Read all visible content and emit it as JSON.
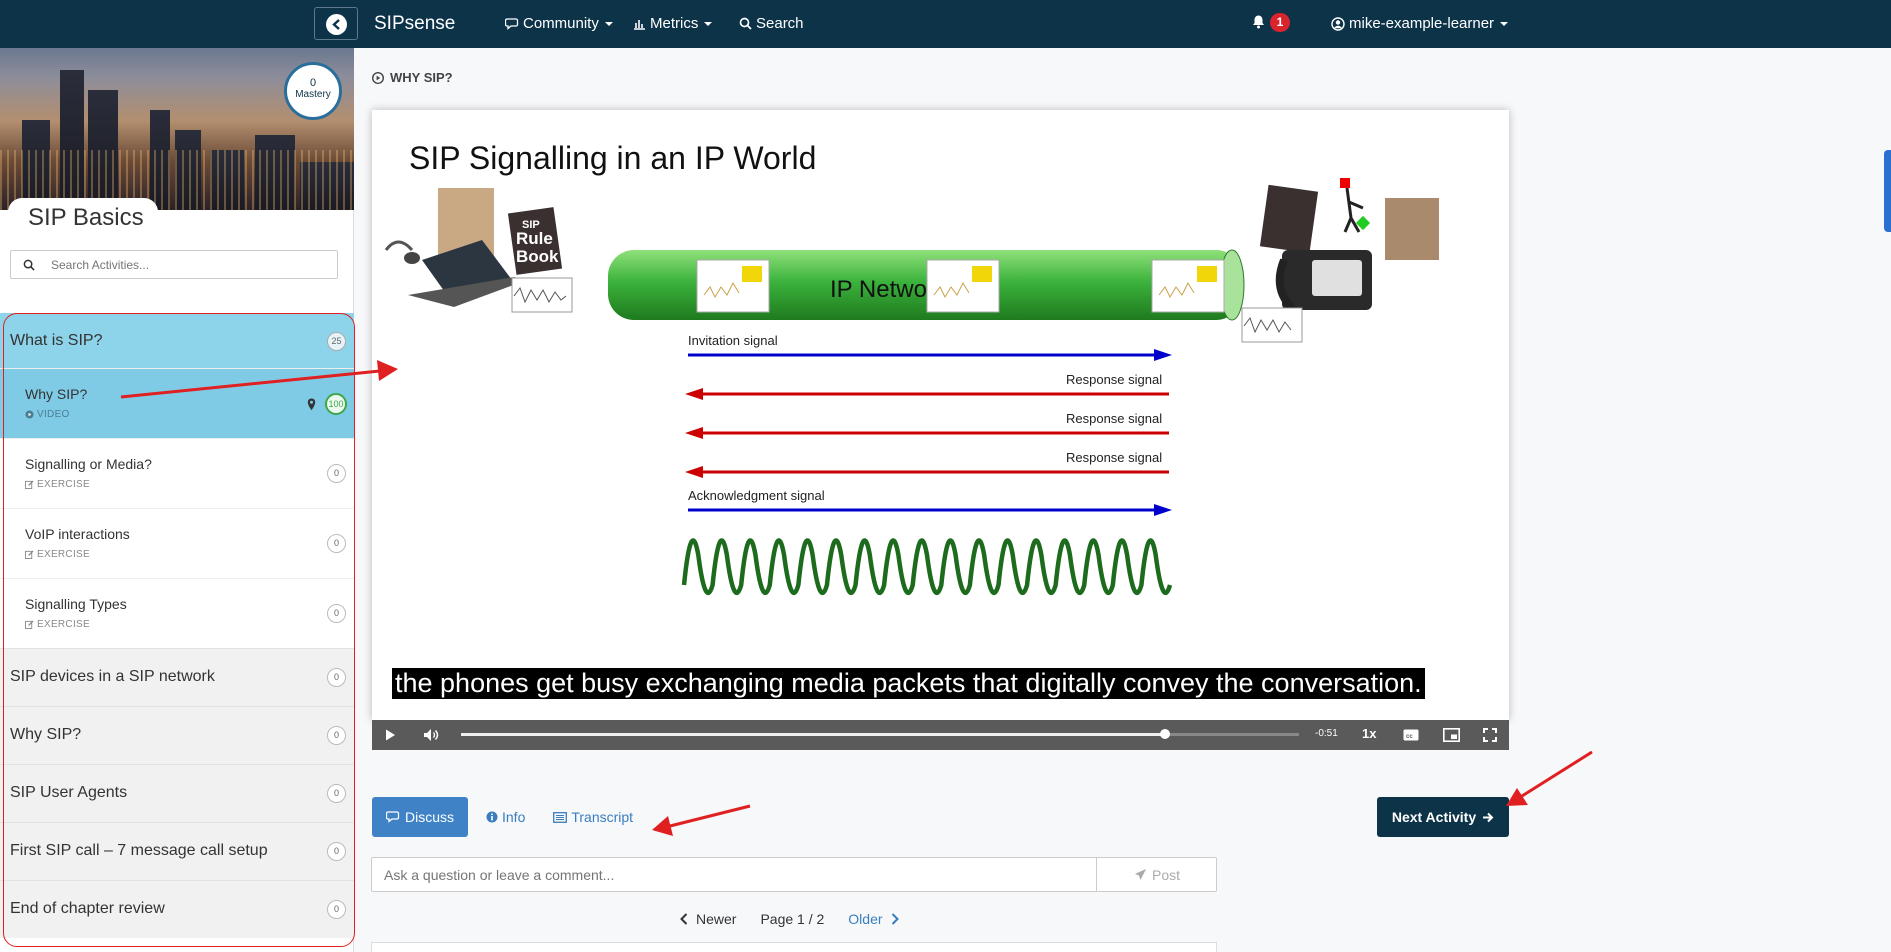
{
  "nav": {
    "brand": "SIPsense",
    "community": "Community",
    "metrics": "Metrics",
    "search": "Search",
    "notifications": "1",
    "user": "mike-example-learner"
  },
  "sidebar": {
    "mastery_value": "0",
    "mastery_label": "Mastery",
    "course_title": "SIP Basics",
    "search_placeholder": "Search Activities...",
    "active_section": {
      "title": "What is SIP?",
      "count": "25"
    },
    "items": [
      {
        "title": "Why SIP?",
        "kind": "VIDEO",
        "count": "100"
      },
      {
        "title": "Signalling or Media?",
        "kind": "EXERCISE",
        "count": "0"
      },
      {
        "title": "VoIP interactions",
        "kind": "EXERCISE",
        "count": "0"
      },
      {
        "title": "Signalling Types",
        "kind": "EXERCISE",
        "count": "0"
      }
    ],
    "sections": [
      {
        "title": "SIP devices in a SIP network",
        "count": "0"
      },
      {
        "title": "Why SIP?",
        "count": "0"
      },
      {
        "title": "SIP User Agents",
        "count": "0"
      },
      {
        "title": "First SIP call – 7 message call setup",
        "count": "0"
      },
      {
        "title": "End of chapter review",
        "count": "0"
      }
    ]
  },
  "main": {
    "breadcrumb": "WHY SIP?",
    "slide": {
      "title": "SIP Signalling in an IP World",
      "book_line1": "SIP",
      "book_line2": "Rule",
      "book_line3": "Book",
      "network_label": "IP Netwo",
      "signals": [
        "Invitation signal",
        "Response signal",
        "Response signal",
        "Response signal",
        "Acknowledgment signal"
      ]
    },
    "caption": "the phones get busy exchanging media packets that digitally convey the conversation.",
    "player": {
      "time": "-0:51",
      "rate": "1x",
      "progress": 0.84
    },
    "tabs": {
      "discuss": "Discuss",
      "info": "Info",
      "transcript": "Transcript"
    },
    "next_button": "Next Activity",
    "comment_placeholder": "Ask a question or leave a comment...",
    "post_button": "Post",
    "pager": {
      "newer": "Newer",
      "page": "Page 1 / 2",
      "older": "Older"
    }
  },
  "colors": {
    "navbar": "#0d3349",
    "active_section": "#8dd3ea",
    "active_item": "#7fcbe6",
    "discuss": "#3f83c6",
    "annotation": "#e02020"
  }
}
